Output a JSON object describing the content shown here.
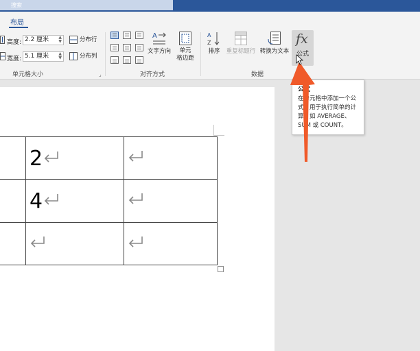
{
  "title_bar": {
    "search_label": "搜索"
  },
  "tabs": {
    "active": "布局"
  },
  "ribbon": {
    "cell_size": {
      "height_label": "高度:",
      "height_value": "2.2 厘米",
      "width_label": "宽度:",
      "width_value": "5.1 厘米",
      "distribute_rows": "分布行",
      "distribute_cols": "分布列",
      "group_label": "单元格大小"
    },
    "alignment": {
      "text_direction": "文字方向",
      "cell_margins_line1": "单元",
      "cell_margins_line2": "格边距",
      "group_label": "对齐方式"
    },
    "data": {
      "sort": "排序",
      "repeat_header": "重复标题行",
      "convert_to_text": "转换为文本",
      "formula": "公式",
      "group_label": "数据"
    }
  },
  "tooltip": {
    "title": "公式",
    "body": "在单元格中添加一个公式，用于执行简单的计算，如 AVERAGE、SUM 或 COUNT。"
  },
  "table": {
    "rows": [
      [
        "2",
        ""
      ],
      [
        "4",
        ""
      ],
      [
        "",
        ""
      ]
    ]
  },
  "colors": {
    "accent": "#2b579a",
    "callout_arrow": "#f05a2a"
  },
  "icons": [
    "height-icon",
    "width-icon",
    "distribute-rows-icon",
    "distribute-cols-icon",
    "text-direction-icon",
    "cell-margins-icon",
    "sort-icon",
    "repeat-header-icon",
    "convert-to-text-icon",
    "formula-icon",
    "paragraph-return-icon"
  ]
}
